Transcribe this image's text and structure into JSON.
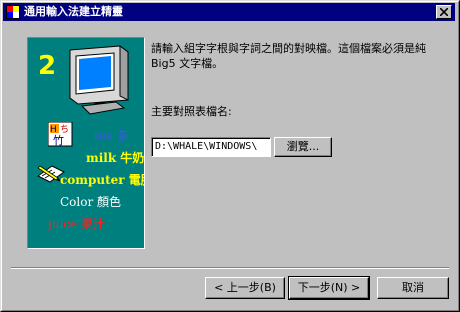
{
  "window": {
    "title": "通用輸入法建立精靈",
    "close_icon": "close-icon",
    "app_icon": "app-icon"
  },
  "illustration": {
    "step_number": "2",
    "words": {
      "tea": "tea 茶",
      "milk": "milk 牛奶",
      "computer": "computer 電腦",
      "color": "Color 顏色",
      "juice": "juice 果汁"
    },
    "colors": {
      "background": "#007f7f",
      "number": "#ffff00"
    }
  },
  "content": {
    "description": "請輸入組字字根與字詞之間的對映檔。這個檔案必須是純 Big5 文字檔。",
    "field_label": "主要對照表檔名:",
    "path_value": "D:\\WHALE\\WINDOWS\\",
    "browse_label": "瀏覽..."
  },
  "footer": {
    "back_label": "< 上一步(B)",
    "next_label": "下一步(N) >",
    "cancel_label": "取消"
  }
}
